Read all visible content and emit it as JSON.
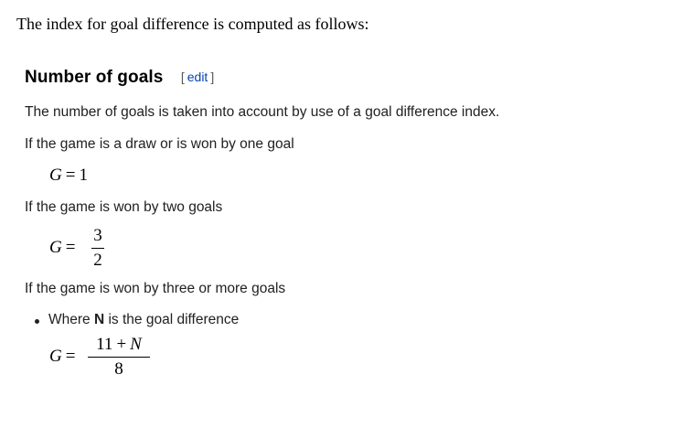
{
  "intro": "The index for goal difference is computed as follows:",
  "section": {
    "title": "Number of goals",
    "edit_open": "[",
    "edit_label": "edit",
    "edit_close": "]"
  },
  "paragraphs": {
    "p1": "The number of goals is taken into account by use of a goal difference index.",
    "p2": "If the game is a draw or is won by one goal",
    "p3": "If the game is won by two goals",
    "p4": "If the game is won by three or more goals"
  },
  "formulas": {
    "f1": {
      "lhs": "G",
      "op": "=",
      "rhs": "1"
    },
    "f2": {
      "lhs": "G",
      "op": "=",
      "num": "3",
      "den": "2"
    },
    "f3": {
      "lhs": "G",
      "op": "=",
      "num_a": "11",
      "num_op": "+",
      "num_b": "N",
      "den": "8"
    }
  },
  "bullet": {
    "prefix": "Where",
    "var": "N",
    "suffix": "is the goal difference"
  }
}
